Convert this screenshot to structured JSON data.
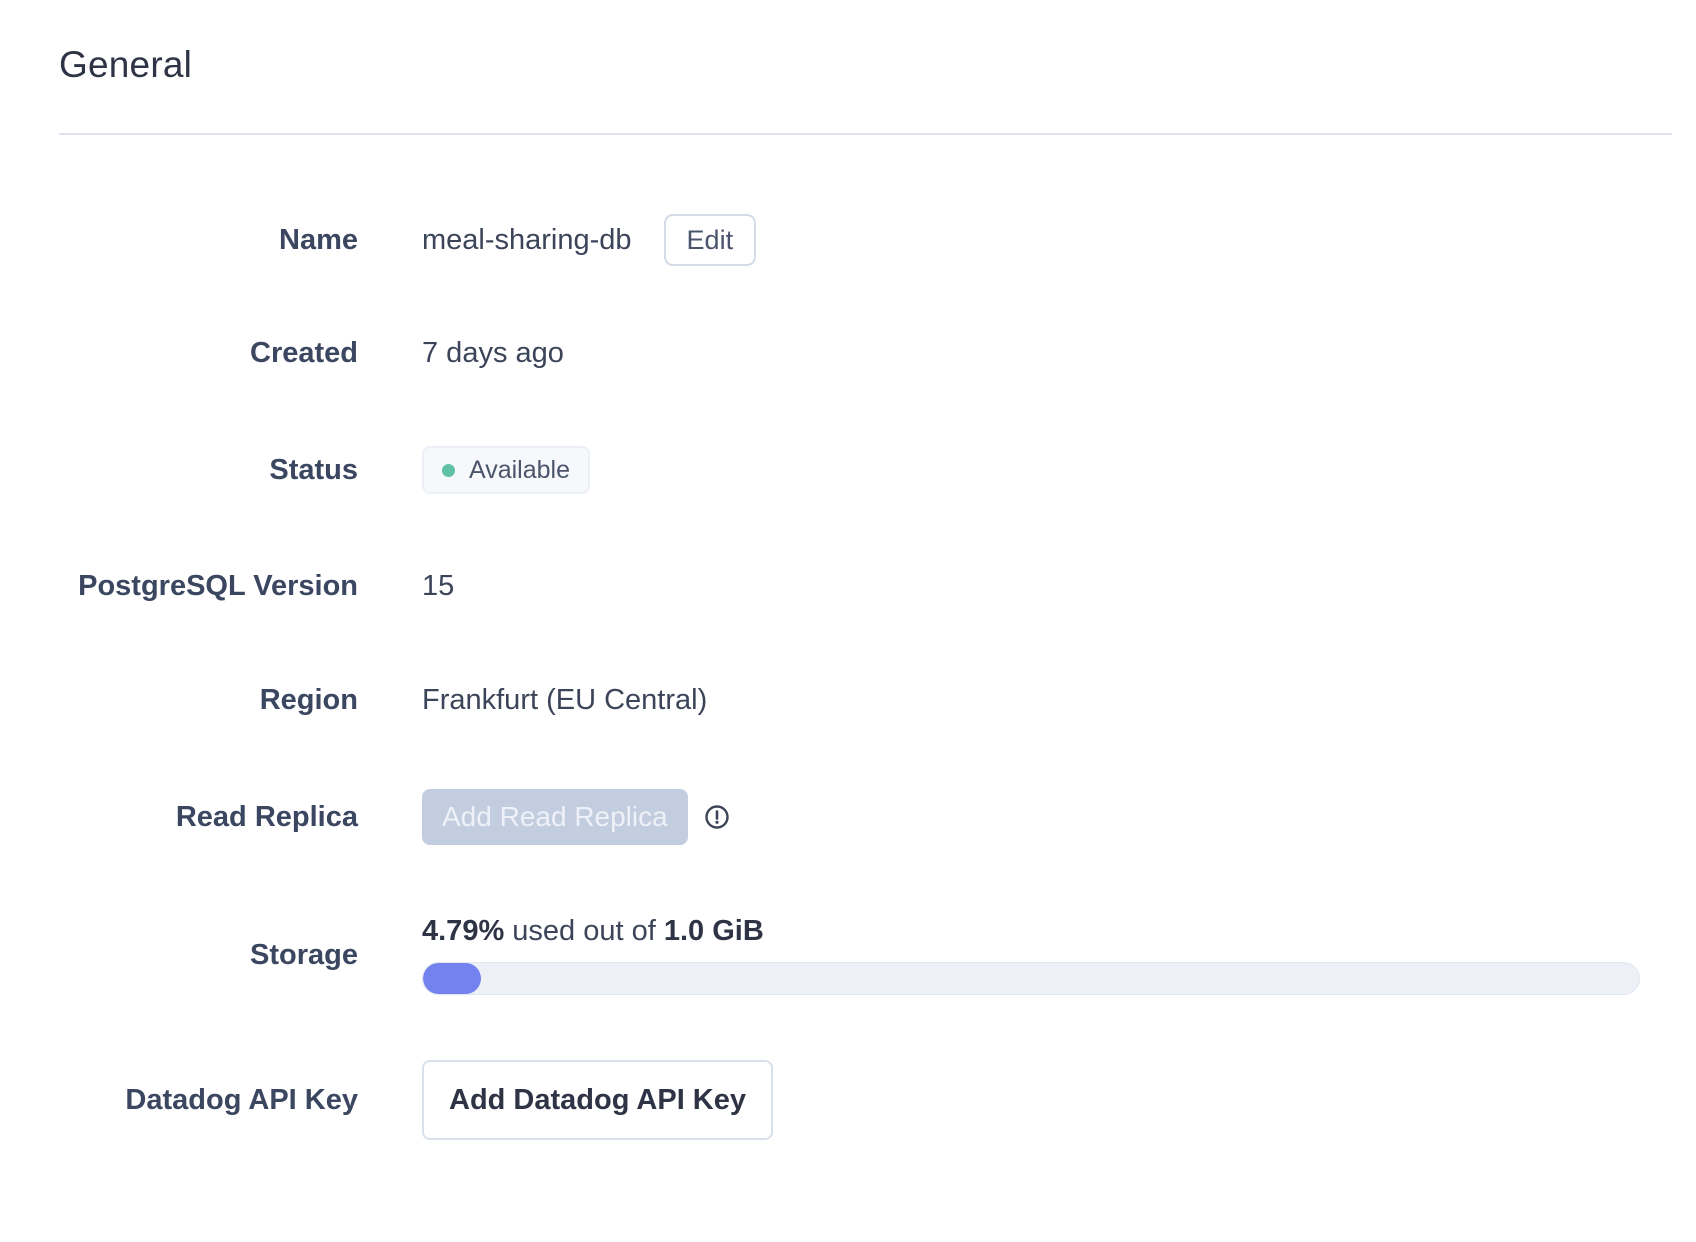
{
  "section": {
    "title": "General"
  },
  "fields": {
    "name": {
      "label": "Name",
      "value": "meal-sharing-db",
      "edit_label": "Edit"
    },
    "created": {
      "label": "Created",
      "value": "7 days ago"
    },
    "status": {
      "label": "Status",
      "value": "Available",
      "dot_color": "#5fc1a6"
    },
    "version": {
      "label": "PostgreSQL Version",
      "value": "15"
    },
    "region": {
      "label": "Region",
      "value": "Frankfurt (EU Central)"
    },
    "read_replica": {
      "label": "Read Replica",
      "button_label": "Add Read Replica",
      "button_disabled": true,
      "info_icon": "info-icon"
    },
    "storage": {
      "label": "Storage",
      "used_percent_text": "4.79%",
      "middle_text": " used out of ",
      "total_text": "1.0 GiB",
      "used_fraction": 0.0479
    },
    "datadog": {
      "label": "Datadog API Key",
      "button_label": "Add Datadog API Key"
    }
  },
  "colors": {
    "progress_fill": "#7482f0",
    "disabled_button_bg": "#c3cde0",
    "disabled_button_text": "#eef1f7",
    "status_dot": "#5fc1a6"
  }
}
